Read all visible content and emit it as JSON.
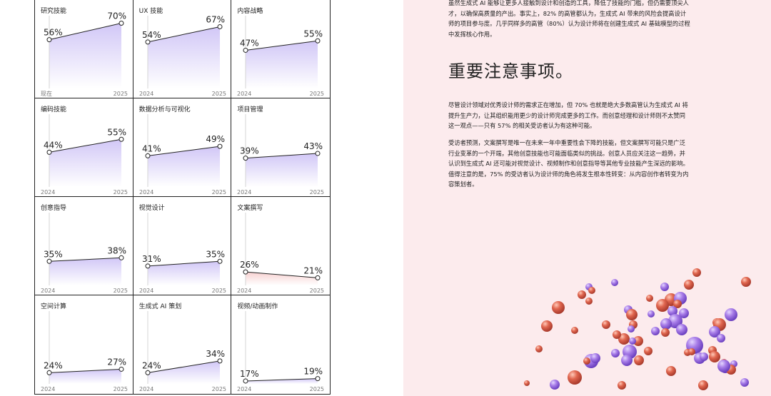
{
  "chart_data": [
    {
      "type": "line",
      "title": "研究技能",
      "categories": [
        "现在",
        "2025"
      ],
      "values": [
        56,
        70
      ],
      "labels": [
        "56%",
        "70%"
      ]
    },
    {
      "type": "line",
      "title": "UX 技能",
      "categories": [
        "2024",
        "2025"
      ],
      "values": [
        54,
        67
      ],
      "labels": [
        "54%",
        "67%"
      ]
    },
    {
      "type": "line",
      "title": "内容战略",
      "categories": [
        "2024",
        "2025"
      ],
      "values": [
        47,
        55
      ],
      "labels": [
        "47%",
        "55%"
      ]
    },
    {
      "type": "line",
      "title": "编码技能",
      "categories": [
        "2024",
        "2025"
      ],
      "values": [
        44,
        55
      ],
      "labels": [
        "44%",
        "55%"
      ]
    },
    {
      "type": "line",
      "title": "数据分析与可视化",
      "categories": [
        "2024",
        "2025"
      ],
      "values": [
        41,
        49
      ],
      "labels": [
        "41%",
        "49%"
      ]
    },
    {
      "type": "line",
      "title": "项目管理",
      "categories": [
        "2024",
        "2025"
      ],
      "values": [
        39,
        43
      ],
      "labels": [
        "39%",
        "43%"
      ]
    },
    {
      "type": "line",
      "title": "创意指导",
      "categories": [
        "2024",
        "2025"
      ],
      "values": [
        35,
        38
      ],
      "labels": [
        "35%",
        "38%"
      ]
    },
    {
      "type": "line",
      "title": "视觉设计",
      "categories": [
        "2024",
        "2025"
      ],
      "values": [
        31,
        35
      ],
      "labels": [
        "31%",
        "35%"
      ]
    },
    {
      "type": "line",
      "title": "文案撰写",
      "categories": [
        "2024",
        "2025"
      ],
      "values": [
        26,
        21
      ],
      "labels": [
        "26%",
        "21%"
      ]
    },
    {
      "type": "line",
      "title": "空间计算",
      "categories": [
        "2024",
        "2025"
      ],
      "values": [
        24,
        27
      ],
      "labels": [
        "24%",
        "27%"
      ]
    },
    {
      "type": "line",
      "title": "生成式 AI 策划",
      "categories": [
        "2024",
        "2025"
      ],
      "values": [
        24,
        34
      ],
      "labels": [
        "24%",
        "34%"
      ]
    },
    {
      "type": "line",
      "title": "视频/动画制作",
      "categories": [
        "2024",
        "2025"
      ],
      "values": [
        17,
        19
      ],
      "labels": [
        "17%",
        "19%"
      ]
    }
  ],
  "colors": {
    "rise_fill": "#c9bdf5",
    "fall_fill": "#f6c9c9",
    "line": "#222222",
    "panel_bg": "#fcebed",
    "sphere_purple": "#9b6fe0",
    "sphere_red": "#d9604f"
  },
  "text": {
    "intro": "虽然生成式 AI 能够让更多人接触到设计和创造的工具，降低了技能的门槛，但仍需要顶尖人才，以确保高质量的产出。事实上，82% 的高管都认为，生成式 AI 带来的风险会提高设计师的项目参与度。几乎同样多的高管（80%）认为设计师将在创建生成式 AI 基础模型的过程中发挥核心作用。",
    "heading": "重要注意事项。",
    "para1": "尽管设计领域对优秀设计师的需求正在增加，但 70% 也就是绝大多数高管认为生成式 AI 将提升生产力，让其组织能用更少的设计师完成更多的工作。而创意经理和设计师则不太赞同这一观点——只有 57% 的相关受访者认为有这种可能。",
    "para2": "受访者预测，文案撰写是唯一在未来一年中重要性会下降的技能，但文案撰写可能只是广泛行业变革的一个开端，其他创意技能也可能面临类似的挑战。创意人员应关注这一趋势，并认识到生成式 AI 还可能对视觉设计、视频制作和创意指导等其他专业技能产生深远的影响。值得注意的是，75% 的受访者认为设计师的角色将发生根本性转变：从内容创作者转变为内容策划者。"
  }
}
